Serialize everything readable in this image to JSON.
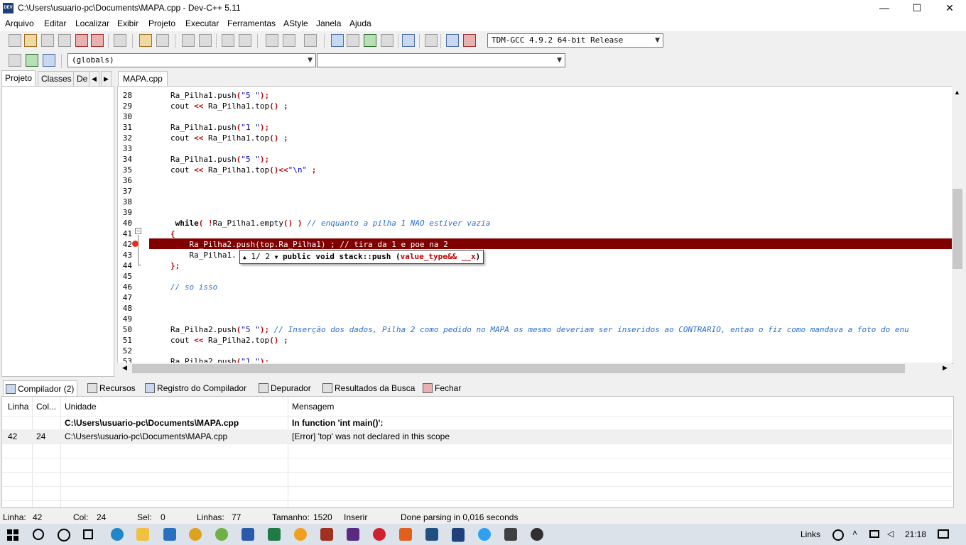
{
  "window": {
    "title": "C:\\Users\\usuario-pc\\Documents\\MAPA.cpp - Dev-C++ 5.11",
    "logo_text": "DEV",
    "minimize": "—",
    "maximize": "☐",
    "close": "✕"
  },
  "menu": [
    "Arquivo",
    "Editar",
    "Localizar",
    "Exibir",
    "Projeto",
    "Executar",
    "Ferramentas",
    "AStyle",
    "Janela",
    "Ajuda"
  ],
  "compiler_select": {
    "value": "TDM-GCC 4.9.2 64-bit Release"
  },
  "scope_select": {
    "value": "(globals)",
    "second_value": ""
  },
  "left_tabs": [
    "Projeto",
    "Classes",
    "De"
  ],
  "editor_tab": "MAPA.cpp",
  "code_lines": [
    {
      "n": "28",
      "t": "Ra_Pilha1.push(\"5 \");"
    },
    {
      "n": "29",
      "t": "cout << Ra_Pilha1.top() ;"
    },
    {
      "n": "30",
      "t": ""
    },
    {
      "n": "31",
      "t": "Ra_Pilha1.push(\"1 \");"
    },
    {
      "n": "32",
      "t": "cout << Ra_Pilha1.top() ;"
    },
    {
      "n": "33",
      "t": ""
    },
    {
      "n": "34",
      "t": "Ra_Pilha1.push(\"5 \");"
    },
    {
      "n": "35",
      "t": "cout << Ra_Pilha1.top()<<\"\\n\" ;"
    },
    {
      "n": "36",
      "t": ""
    },
    {
      "n": "37",
      "t": ""
    },
    {
      "n": "38",
      "t": ""
    },
    {
      "n": "39",
      "t": ""
    },
    {
      "n": "40",
      "t": " while( !Ra_Pilha1.empty() ) // enquanto a pilha 1 NAO estiver vazia"
    },
    {
      "n": "41",
      "t": "{"
    },
    {
      "n": "42",
      "t": "    Ra_Pilha2.push(top.Ra_Pilha1) ; // tira da 1 e poe na 2"
    },
    {
      "n": "43",
      "t": "    Ra_Pilha1."
    },
    {
      "n": "44",
      "t": "};"
    },
    {
      "n": "45",
      "t": ""
    },
    {
      "n": "46",
      "t": "// so isso"
    },
    {
      "n": "47",
      "t": ""
    },
    {
      "n": "48",
      "t": ""
    },
    {
      "n": "49",
      "t": ""
    },
    {
      "n": "50",
      "t": "Ra_Pilha2.push(\"5 \"); // Inserção dos dados, Pilha 2 como pedido no MAPA os mesmo deveriam ser inseridos ao CONTRARIO, entao o fiz como mandava a foto do enu"
    },
    {
      "n": "51",
      "t": "cout << Ra_Pilha2.top() ;"
    },
    {
      "n": "52",
      "t": ""
    },
    {
      "n": "53",
      "t": "Ra_Pilha2.push(\"1 \");"
    }
  ],
  "tooltip": {
    "counter": "1/ 2",
    "signature": "public void stack::push (",
    "param": "value_type&& __x",
    "close": ")"
  },
  "bottom_tabs": [
    "Compilador (2)",
    "Recursos",
    "Registro do Compilador",
    "Depurador",
    "Resultados da Busca",
    "Fechar"
  ],
  "messages": {
    "headers": [
      "Linha",
      "Col...",
      "Unidade",
      "Mensagem"
    ],
    "rows": [
      {
        "line": "",
        "col": "",
        "unit": "C:\\Users\\usuario-pc\\Documents\\MAPA.cpp",
        "msg": "In function 'int main()':"
      },
      {
        "line": "42",
        "col": "24",
        "unit": "C:\\Users\\usuario-pc\\Documents\\MAPA.cpp",
        "msg": "[Error] 'top' was not declared in this scope"
      }
    ]
  },
  "status": {
    "line_label": "Linha:",
    "line": "42",
    "col_label": "Col:",
    "col": "24",
    "sel_label": "Sel:",
    "sel": "0",
    "lines_label": "Linhas:",
    "lines": "77",
    "size_label": "Tamanho:",
    "size": "1520",
    "mode": "Inserir",
    "parse": "Done parsing in 0,016 seconds"
  },
  "taskbar": {
    "links": "Links",
    "time": "21:18"
  },
  "colors": {
    "error_line": "#800000",
    "comment": "#2a6fd0",
    "string": "#0000c0",
    "operator": "#c00000"
  }
}
